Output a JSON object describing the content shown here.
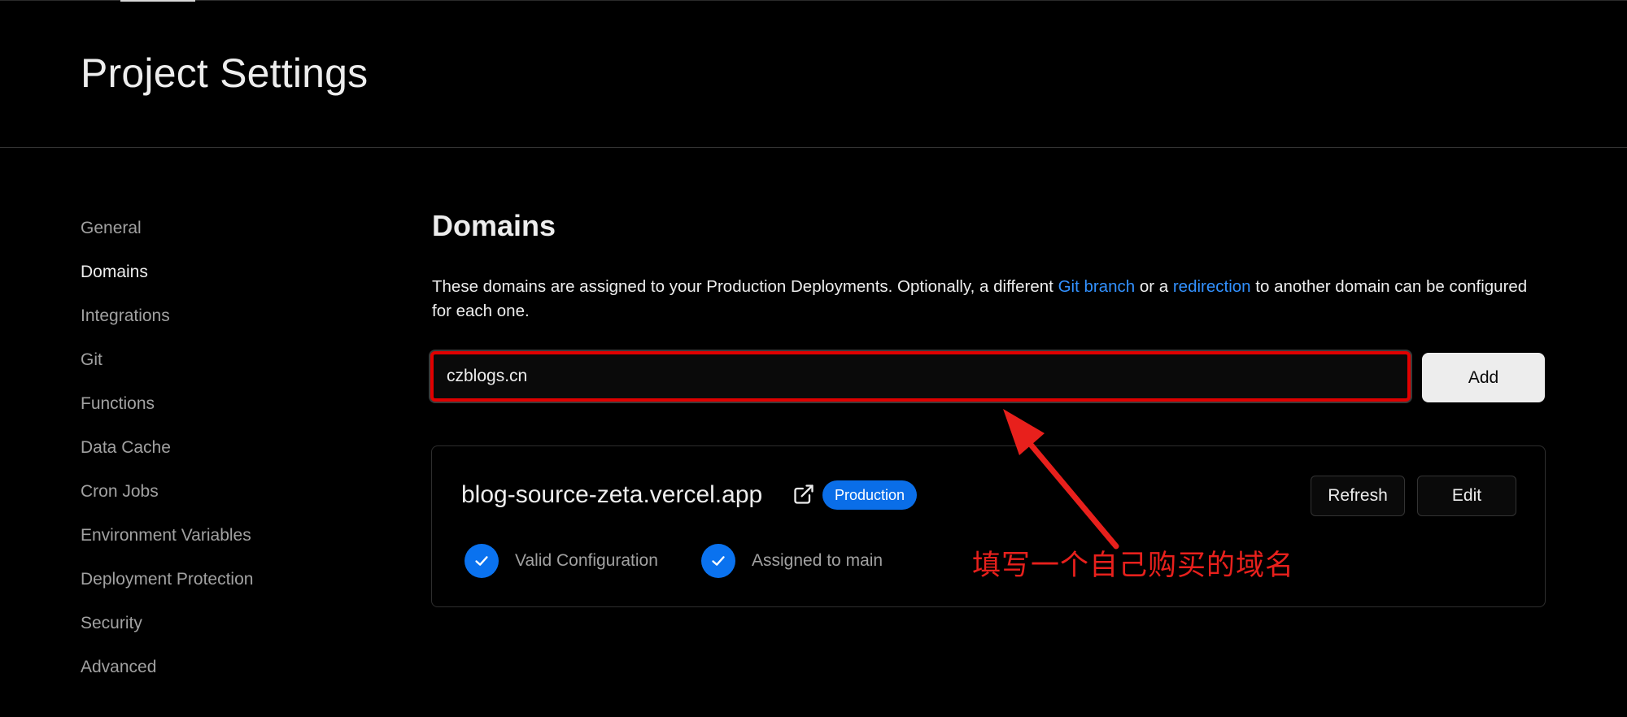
{
  "header": {
    "title": "Project Settings"
  },
  "sidebar": {
    "items": [
      {
        "label": "General"
      },
      {
        "label": "Domains"
      },
      {
        "label": "Integrations"
      },
      {
        "label": "Git"
      },
      {
        "label": "Functions"
      },
      {
        "label": "Data Cache"
      },
      {
        "label": "Cron Jobs"
      },
      {
        "label": "Environment Variables"
      },
      {
        "label": "Deployment Protection"
      },
      {
        "label": "Security"
      },
      {
        "label": "Advanced"
      }
    ],
    "active": "Domains"
  },
  "main": {
    "section_title": "Domains",
    "description": {
      "part1": "These domains are assigned to your Production Deployments. Optionally, a different ",
      "link1": "Git branch",
      "part2": " or a ",
      "link2": "redirection",
      "part3": " to another domain can be configured for each one."
    },
    "domain_input": {
      "value": "czblogs.cn",
      "placeholder": ""
    },
    "add_label": "Add",
    "domain_card": {
      "domain": "blog-source-zeta.vercel.app",
      "badge": "Production",
      "refresh_label": "Refresh",
      "edit_label": "Edit",
      "statuses": [
        {
          "label": "Valid Configuration",
          "icon": "check-icon"
        },
        {
          "label": "Assigned to main",
          "icon": "check-icon"
        }
      ]
    }
  },
  "annotation": {
    "text": "填写一个自己购买的域名",
    "color": "#e8201c"
  },
  "colors": {
    "background": "#000000",
    "link": "#3291ff",
    "badge": "#0a6ee8",
    "check": "#0a72ef",
    "highlight_border": "#e00000"
  }
}
